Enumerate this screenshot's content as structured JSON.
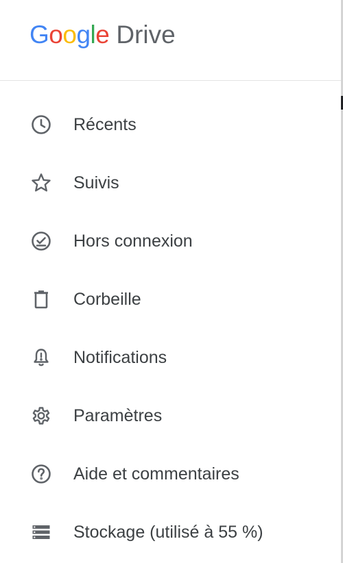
{
  "app": {
    "logo_letters": [
      "G",
      "o",
      "o",
      "g",
      "l",
      "e"
    ],
    "product": "Drive"
  },
  "menu": {
    "items": [
      {
        "label": "Récents",
        "icon": "clock-icon"
      },
      {
        "label": "Suivis",
        "icon": "star-icon"
      },
      {
        "label": "Hors connexion",
        "icon": "offline-check-icon"
      },
      {
        "label": "Corbeille",
        "icon": "trash-icon"
      },
      {
        "label": "Notifications",
        "icon": "bell-alert-icon"
      },
      {
        "label": "Paramètres",
        "icon": "gear-icon"
      },
      {
        "label": "Aide et commentaires",
        "icon": "help-icon"
      },
      {
        "label": "Stockage (utilisé à 55 %)",
        "icon": "storage-icon"
      }
    ]
  },
  "colors": {
    "google_blue": "#4285f4",
    "google_red": "#ea4335",
    "google_yellow": "#fbbc05",
    "google_green": "#34a853",
    "text": "#3c4043",
    "icon": "#5f6368"
  }
}
